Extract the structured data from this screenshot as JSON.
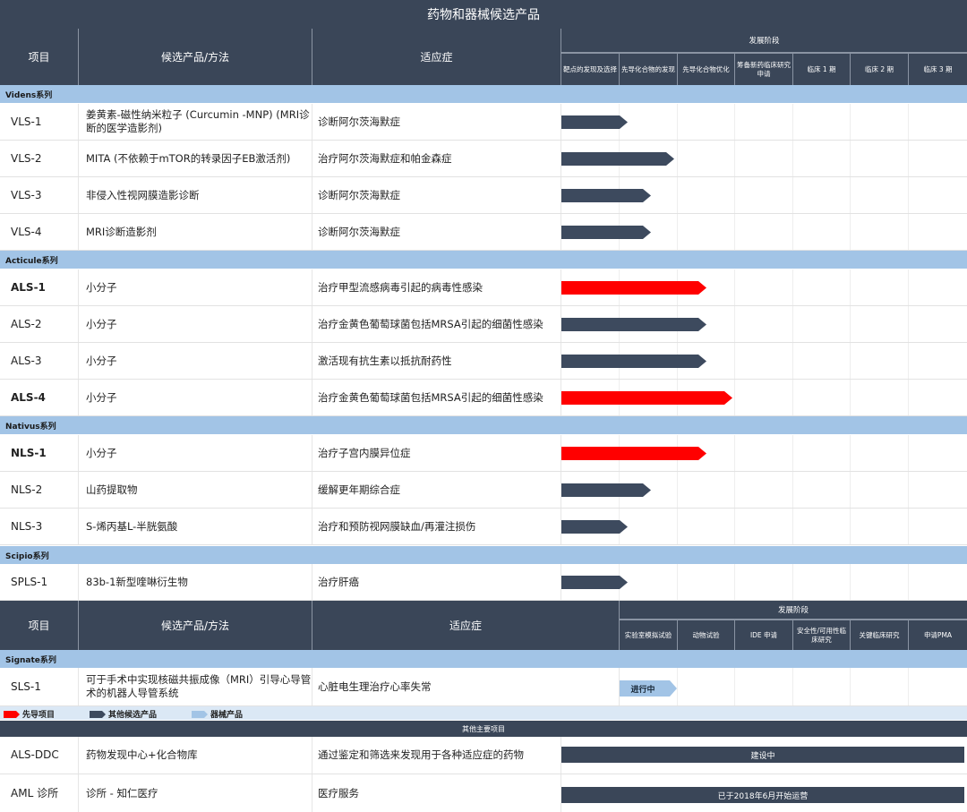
{
  "title": "药物和器械候选产品",
  "header": {
    "col_project": "项目",
    "col_candidate": "候选产品/方法",
    "col_indication": "适应症",
    "stage_group": "发展阶段",
    "stages": [
      "靶点的发现及选择",
      "先导化合物的发现",
      "先导化合物优化",
      "筹备新药临床研究申请",
      "临床 1 期",
      "临床 2 期",
      "临床 3 期"
    ]
  },
  "sections": {
    "videns": "Videns系列",
    "acticule": "Acticule系列",
    "nativus": "Nativus系列",
    "scipio": "Scipio系列",
    "signate": "Signate系列"
  },
  "rows": [
    {
      "project": "VLS-1",
      "candidate": "姜黄素-磁性纳米粒子 (Curcumin -MNP) (MRI诊断的医学造影剂)",
      "indication": "诊断阿尔茨海默症",
      "bar_color": "#3d4a5e",
      "progress_stages": 1.15,
      "lead": false
    },
    {
      "project": "VLS-2",
      "candidate": "MITA (不依赖于mTOR的转录因子EB激活剂)",
      "indication": "治疗阿尔茨海默症和帕金森症",
      "bar_color": "#3d4a5e",
      "progress_stages": 1.95,
      "lead": false
    },
    {
      "project": "VLS-3",
      "candidate": "非侵入性视网膜造影诊断",
      "indication": "诊断阿尔茨海默症",
      "bar_color": "#3d4a5e",
      "progress_stages": 1.55,
      "lead": false
    },
    {
      "project": "VLS-4",
      "candidate": "MRI诊断造影剂",
      "indication": "诊断阿尔茨海默症",
      "bar_color": "#3d4a5e",
      "progress_stages": 1.55,
      "lead": false
    },
    {
      "project": "ALS-1",
      "candidate": "小分子",
      "indication": "治疗甲型流感病毒引起的病毒性感染",
      "bar_color": "#ff0000",
      "progress_stages": 2.5,
      "lead": true
    },
    {
      "project": "ALS-2",
      "candidate": "小分子",
      "indication": "治疗金黄色葡萄球菌包括MRSA引起的细菌性感染",
      "bar_color": "#3d4a5e",
      "progress_stages": 2.5,
      "lead": false
    },
    {
      "project": "ALS-3",
      "candidate": "小分子",
      "indication": "激活现有抗生素以抵抗耐药性",
      "bar_color": "#3d4a5e",
      "progress_stages": 2.5,
      "lead": false
    },
    {
      "project": "ALS-4",
      "candidate": "小分子",
      "indication": "治疗金黄色葡萄球菌包括MRSA引起的细菌性感染",
      "bar_color": "#ff0000",
      "progress_stages": 2.95,
      "lead": true
    },
    {
      "project": "NLS-1",
      "candidate": "小分子",
      "indication": "治疗子宫内膜异位症",
      "bar_color": "#ff0000",
      "progress_stages": 2.5,
      "lead": true
    },
    {
      "project": "NLS-2",
      "candidate": "山药提取物",
      "indication": "缓解更年期综合症",
      "bar_color": "#3d4a5e",
      "progress_stages": 1.55,
      "lead": false
    },
    {
      "project": "NLS-3",
      "candidate": "S-烯丙基L-半胱氨酸",
      "indication": "治疗和预防视网膜缺血/再灌注损伤",
      "bar_color": "#3d4a5e",
      "progress_stages": 1.15,
      "lead": false
    },
    {
      "project": "SPLS-1",
      "candidate": "83b-1新型喹啉衍生物",
      "indication": "治疗肝癌",
      "bar_color": "#3d4a5e",
      "progress_stages": 1.15,
      "lead": false
    }
  ],
  "device_header": {
    "col_project": "项目",
    "col_candidate": "候选产品/方法",
    "col_indication": "适应症",
    "stage_group": "发展阶段",
    "stages": [
      "实验室模拟试验",
      "动物试验",
      "IDE 申请",
      "安全性/可用性临床研究",
      "关键临床研究",
      "申请PMA"
    ]
  },
  "device_row": {
    "project": "SLS-1",
    "candidate": "可于手术中实现核磁共振成像（MRI）引导心导管术的机器人导管系统",
    "indication": "心脏电生理治疗心率失常",
    "status": "进行中",
    "bar_color": "#a2c4e6"
  },
  "legend": {
    "lead": "先导项目",
    "other": "其他候选产品",
    "device": "器械产品",
    "lead_color": "#ff0000",
    "other_color": "#3d4a5e",
    "device_color": "#a2c4e6"
  },
  "other": {
    "header": "其他主要项目",
    "rows": [
      {
        "project": "ALS-DDC",
        "candidate": "药物发现中心+化合物库",
        "indication": "通过鉴定和筛选来发现用于各种适应症的药物",
        "status": "建设中"
      },
      {
        "project": "AML 诊所",
        "candidate": "诊所 - 知仁医疗",
        "indication": "医疗服务",
        "status": "已于2018年6月开始运营"
      }
    ]
  }
}
